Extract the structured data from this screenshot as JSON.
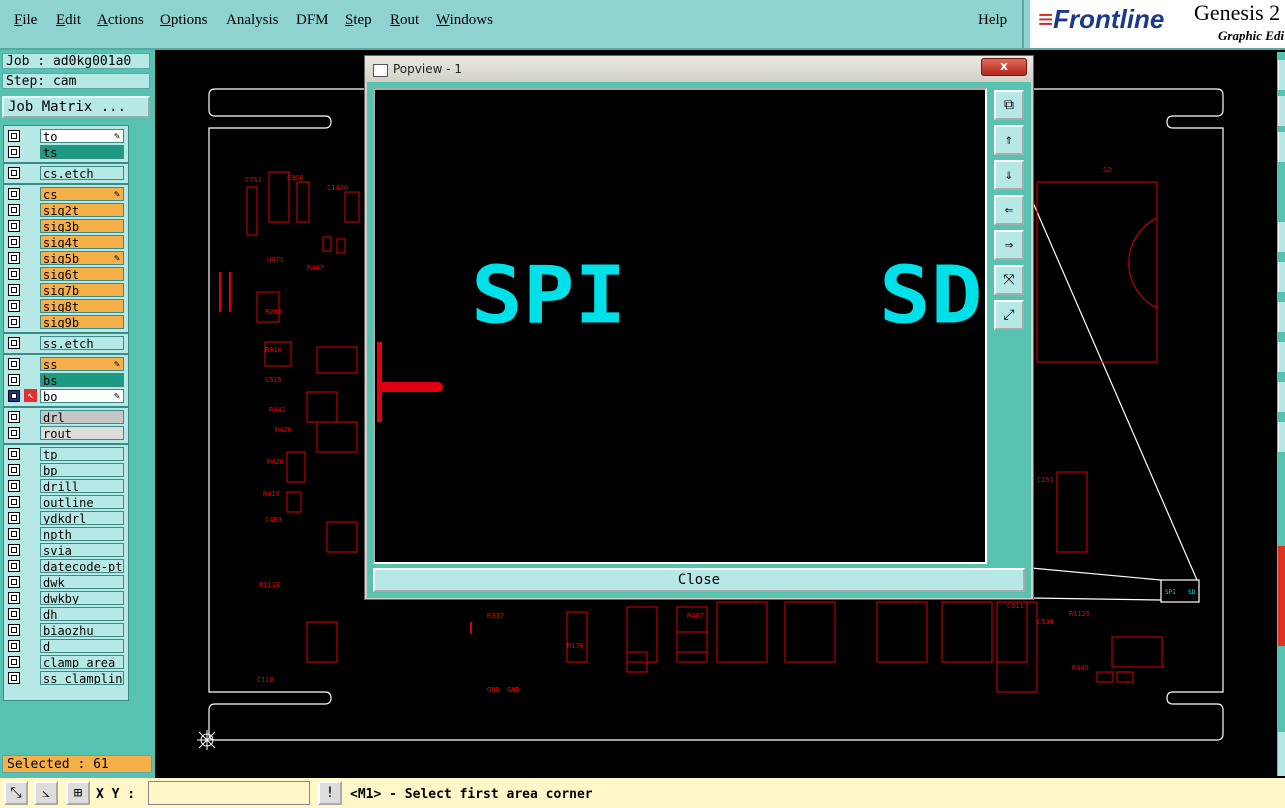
{
  "menubar": {
    "items": [
      {
        "label": "File",
        "ul": "F",
        "rest": "ile"
      },
      {
        "label": "Edit",
        "ul": "E",
        "rest": "dit"
      },
      {
        "label": "Actions",
        "ul": "A",
        "rest": "ctions"
      },
      {
        "label": "Options",
        "ul": "O",
        "rest": "ptions"
      },
      {
        "label": "Analysis",
        "ul": "",
        "rest": "Analysis"
      },
      {
        "label": "DFM",
        "ul": "",
        "rest": "DFM"
      },
      {
        "label": "Step",
        "ul": "S",
        "rest": "tep"
      },
      {
        "label": "Rout",
        "ul": "R",
        "rest": "out"
      },
      {
        "label": "Windows",
        "ul": "W",
        "rest": "indows"
      }
    ],
    "help": "Help"
  },
  "brand": {
    "logo": "Frontline",
    "product": "Genesis 2",
    "tagline": "Graphic Edi"
  },
  "left": {
    "job": "Job : ad0kg001a0",
    "step": "Step: cam",
    "job_matrix": "Job Matrix ...",
    "layers": [
      {
        "name": "to",
        "color": "white",
        "flag": "✎"
      },
      {
        "name": "ts",
        "color": "green",
        "flag": ""
      },
      {
        "name": "cs.etch",
        "color": "teal",
        "flag": "",
        "sep_before": true
      },
      {
        "name": "cs",
        "color": "orange",
        "flag": "✎",
        "sep_before": true
      },
      {
        "name": "sig2t",
        "color": "orange",
        "flag": ""
      },
      {
        "name": "sig3b",
        "color": "orange",
        "flag": ""
      },
      {
        "name": "sig4t",
        "color": "orange",
        "flag": ""
      },
      {
        "name": "sig5b",
        "color": "orange",
        "flag": "✎"
      },
      {
        "name": "sig6t",
        "color": "orange",
        "flag": ""
      },
      {
        "name": "sig7b",
        "color": "orange",
        "flag": ""
      },
      {
        "name": "sig8t",
        "color": "orange",
        "flag": ""
      },
      {
        "name": "sig9b",
        "color": "orange",
        "flag": ""
      },
      {
        "name": "ss.etch",
        "color": "teal",
        "flag": "",
        "sep_before": true
      },
      {
        "name": "ss",
        "color": "orange",
        "flag": "✎",
        "sep_before": true
      },
      {
        "name": "bs",
        "color": "green",
        "flag": ""
      },
      {
        "name": "bo",
        "color": "white",
        "flag": "✎",
        "active": true
      },
      {
        "name": "drl",
        "color": "gray",
        "flag": "",
        "sep_before": true
      },
      {
        "name": "rout",
        "color": "lgray",
        "flag": ""
      },
      {
        "name": "tp",
        "color": "teal",
        "flag": "",
        "sep_before": true
      },
      {
        "name": "bp",
        "color": "teal",
        "flag": ""
      },
      {
        "name": "drill",
        "color": "teal",
        "flag": ""
      },
      {
        "name": "outline",
        "color": "teal",
        "flag": ""
      },
      {
        "name": "ydkdrl",
        "color": "teal",
        "flag": ""
      },
      {
        "name": "npth",
        "color": "teal",
        "flag": ""
      },
      {
        "name": "svia",
        "color": "teal",
        "flag": ""
      },
      {
        "name": "datecode-pto",
        "color": "teal",
        "flag": ""
      },
      {
        "name": "dwk",
        "color": "teal",
        "flag": ""
      },
      {
        "name": "dwkby",
        "color": "teal",
        "flag": ""
      },
      {
        "name": "dh",
        "color": "teal",
        "flag": ""
      },
      {
        "name": "biaozhu",
        "color": "teal",
        "flag": ""
      },
      {
        "name": "d",
        "color": "teal",
        "flag": ""
      },
      {
        "name": "clamp_area",
        "color": "teal",
        "flag": ""
      },
      {
        "name": "ss_clampline",
        "color": "teal",
        "flag": ""
      }
    ],
    "selected": "Selected : 61"
  },
  "popview": {
    "title": "Popview - 1",
    "close_x": "x",
    "close_button": "Close",
    "text_left": "SPI",
    "text_right": "SD",
    "tools": [
      "zoom-fit-icon",
      "pan-up-icon",
      "pan-down-icon",
      "pan-left-icon",
      "pan-right-icon",
      "zoom-out-icon",
      "zoom-in-icon"
    ]
  },
  "status": {
    "xy_label": "X Y :",
    "message": "<M1> - Select first area corner"
  },
  "mini_labels": [
    "SPI",
    "SD"
  ],
  "colors": {
    "accent": "#57c2b0",
    "panel": "#b6e8e6",
    "layer_orange": "#f6b04a",
    "pcb_red": "#dd0000",
    "pop_text": "#00e0e8"
  }
}
